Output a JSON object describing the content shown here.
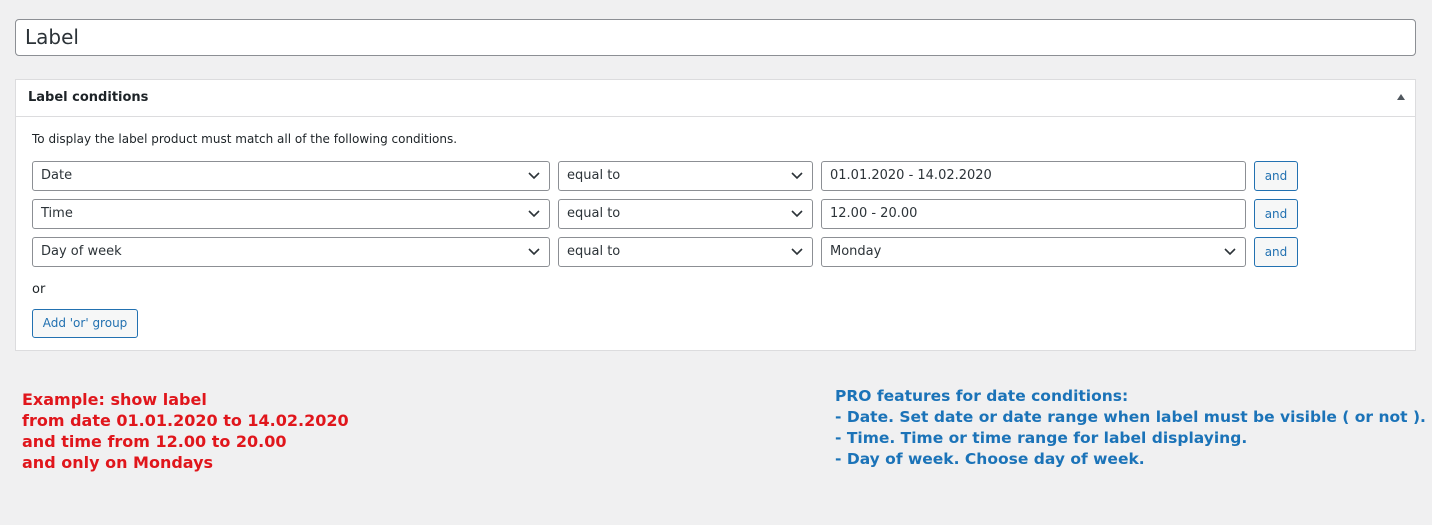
{
  "title_field": {
    "value": "Label"
  },
  "conditions_box": {
    "title": "Label conditions",
    "intro": "To display the label product must match all of the following conditions.",
    "rows": [
      {
        "field": "Date",
        "operator": "equal to",
        "value": "01.01.2020 - 14.02.2020",
        "value_type": "text",
        "and_label": "and"
      },
      {
        "field": "Time",
        "operator": "equal to",
        "value": "12.00 - 20.00",
        "value_type": "text",
        "and_label": "and"
      },
      {
        "field": "Day of week",
        "operator": "equal to",
        "value": "Monday",
        "value_type": "select",
        "and_label": "and"
      }
    ],
    "or_label": "or",
    "add_or_group_label": "Add 'or' group"
  },
  "example_note": {
    "color": "#e0161c",
    "lines": [
      "Example: show label",
      "from date 01.01.2020 to 14.02.2020",
      "and time from 12.00 to 20.00",
      "and only on Mondays"
    ]
  },
  "pro_note": {
    "color": "#1b73b8",
    "lines": [
      "PRO features for date conditions:",
      "- Date. Set date or date range when label must be visible ( or not ).",
      "- Time. Time or time range for label displaying.",
      "- Day of week. Choose day of week."
    ]
  },
  "accent_color": "#2271b1"
}
